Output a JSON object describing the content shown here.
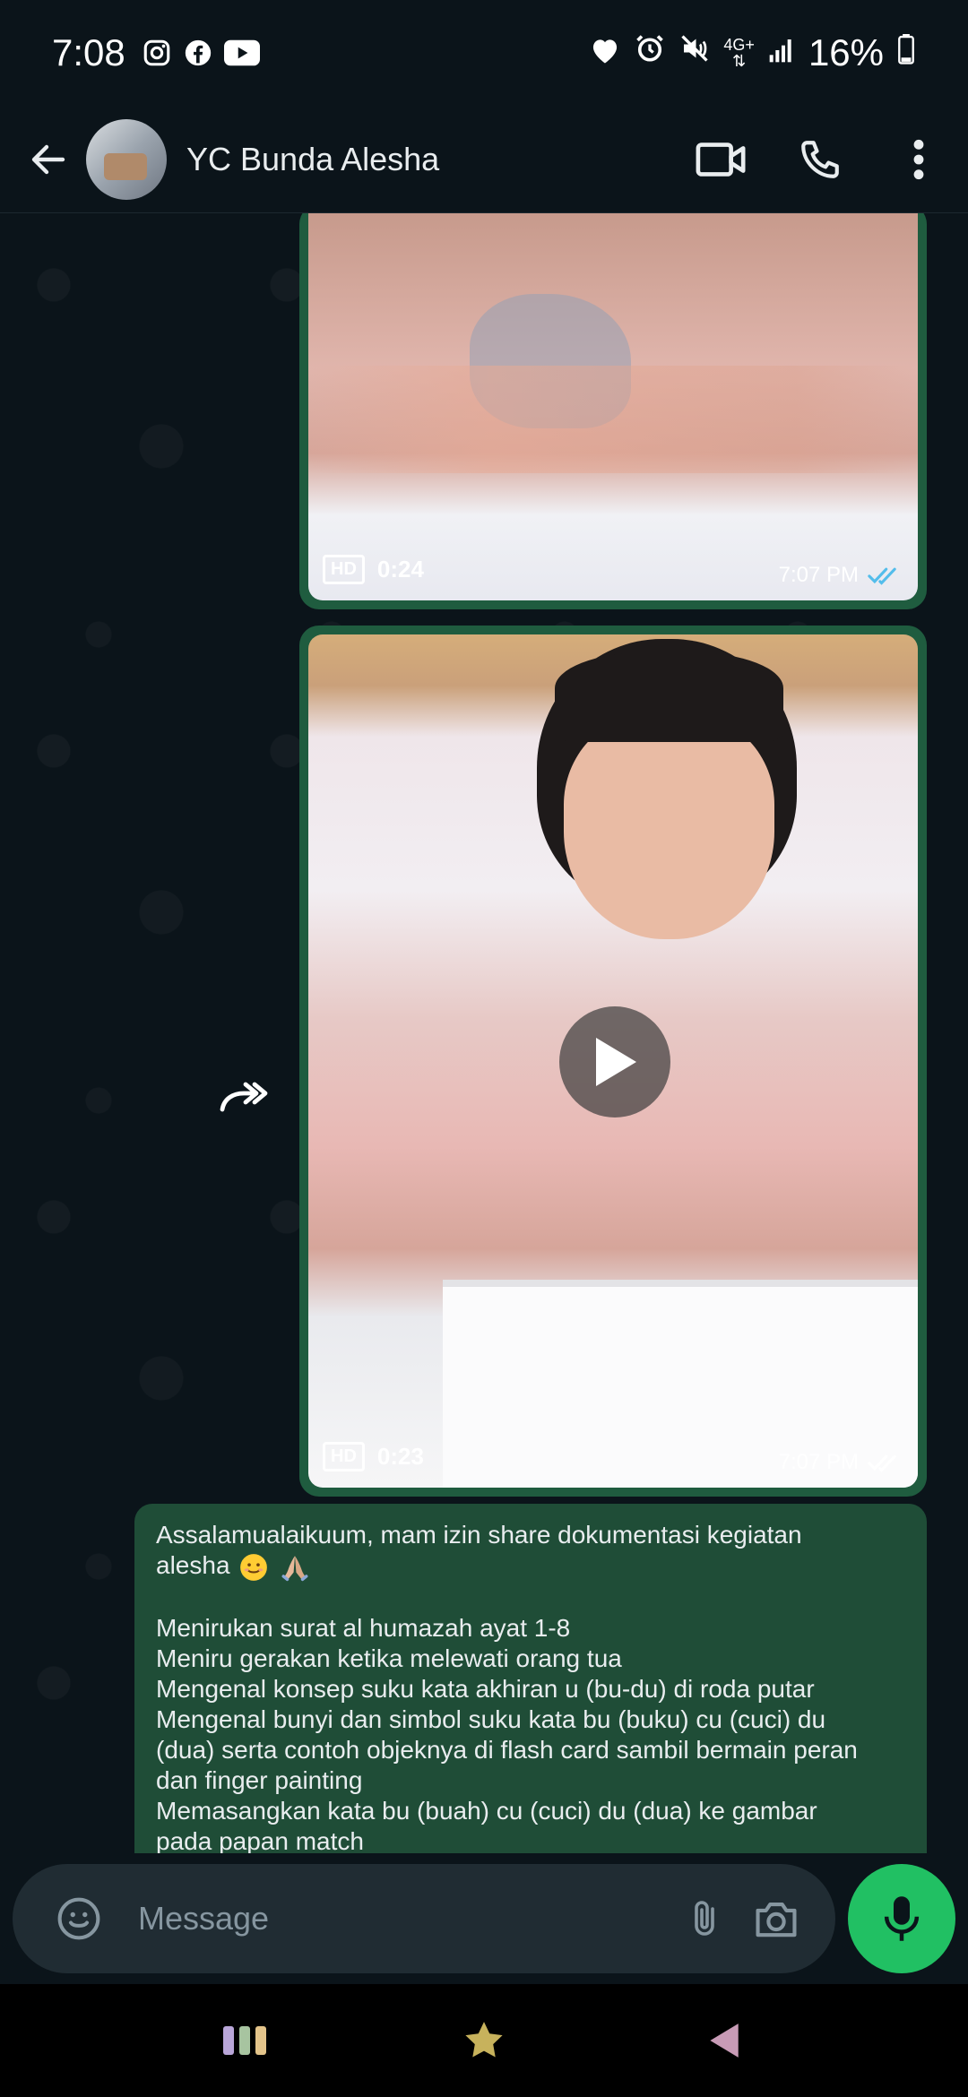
{
  "status_bar": {
    "time": "7:08",
    "battery": "16%",
    "network": "4G+"
  },
  "header": {
    "contact_name": "YC Bunda Alesha"
  },
  "messages": {
    "video1": {
      "hd_label": "HD",
      "duration": "0:24",
      "time": "7:07 PM"
    },
    "video2": {
      "hd_label": "HD",
      "duration": "0:23",
      "time": "7:07 PM"
    },
    "text": {
      "line1": "Assalamualaikuum, mam izin share dokumentasi kegiatan",
      "line2": "alesha",
      "line3": "Menirukan surat al humazah ayat 1-8",
      "line4": "Meniru gerakan ketika melewati orang tua",
      "line5": "Mengenal konsep suku kata akhiran u (bu-du) di roda putar",
      "line6": "Mengenal bunyi dan simbol suku kata bu (buku) cu (cuci) du",
      "line7": "(dua) serta contoh objeknya di flash card sambil bermain peran",
      "line8": "dan finger painting",
      "line9": "Memasangkan kata bu (buah) cu (cuci) du (dua) ke gambar",
      "line10": "pada papan match"
    }
  },
  "input": {
    "placeholder": "Message"
  },
  "colors": {
    "accent": "#21c063",
    "outgoing_bubble": "#1f4d37",
    "read_ticks": "#53bdeb"
  }
}
